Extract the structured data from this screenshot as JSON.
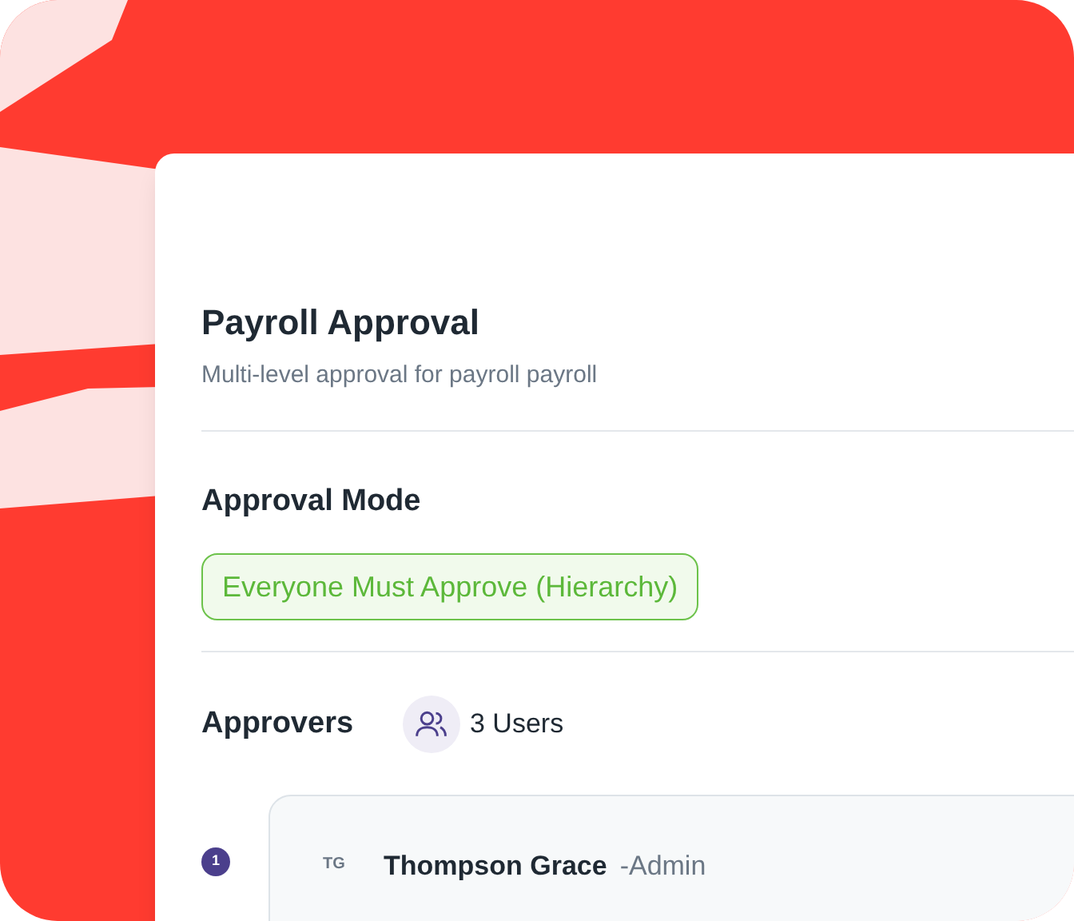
{
  "title": "Payroll Approval",
  "description": "Multi-level approval for payroll payroll",
  "approval_mode": {
    "heading": "Approval Mode",
    "value": "Everyone Must Approve (Hierarchy)"
  },
  "approvers": {
    "heading": "Approvers",
    "count": "3 Users",
    "items": [
      {
        "step": "1",
        "initials": "TG",
        "name": "Thompson Grace",
        "role": "-Admin"
      }
    ]
  }
}
